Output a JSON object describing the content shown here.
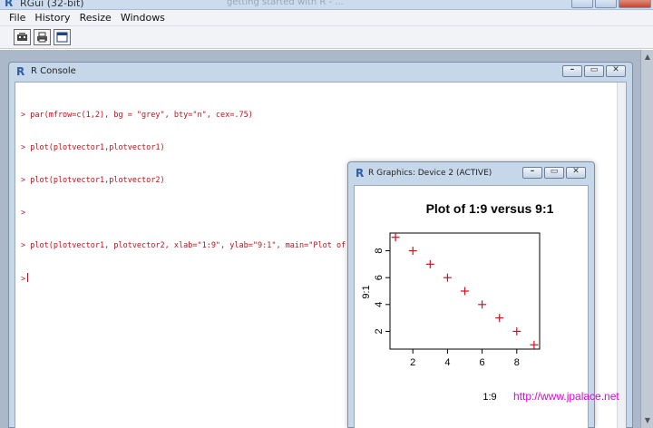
{
  "app": {
    "title": "RGui (32-bit)",
    "ghost_text": "getting started with R - ..."
  },
  "menu": [
    "File",
    "History",
    "Resize",
    "Windows"
  ],
  "toolbar": {
    "icons": [
      "open-script-icon",
      "print-icon",
      "console-window-icon"
    ]
  },
  "console": {
    "title": "R Console",
    "lines": [
      "> par(mfrow=c(1,2), bg = \"grey\", bty=\"n\", cex=.75)",
      "> plot(plotvector1,plotvector1)",
      "> plot(plotvector1,plotvector2)",
      ">",
      "> plot(plotvector1, plotvector2, xlab=\"1:9\", ylab=\"9:1\", main=\"Plot of 1:9 versus 9:1\", col=\"red\", pch=3)"
    ],
    "prompt": ">"
  },
  "graphics": {
    "title": "R Graphics: Device 2 (ACTIVE)"
  },
  "watermark": "http://www.jpalace.net",
  "colors": {
    "console_text": "#c0111a",
    "points": "#d4101f",
    "watermark": "#e000e0"
  },
  "chart_data": {
    "type": "scatter",
    "title": "Plot of 1:9 versus 9:1",
    "xlabel": "1:9",
    "ylabel": "9:1",
    "x": [
      1,
      2,
      3,
      4,
      5,
      6,
      7,
      8,
      9
    ],
    "y": [
      9,
      8,
      7,
      6,
      5,
      4,
      3,
      2,
      1
    ],
    "x_ticks": [
      2,
      4,
      6,
      8
    ],
    "y_ticks": [
      2,
      4,
      6,
      8
    ],
    "xlim": [
      0.68,
      9.32
    ],
    "ylim": [
      0.68,
      9.32
    ],
    "marker": "+",
    "point_color": "#d4101f",
    "grid": false,
    "box": true
  }
}
